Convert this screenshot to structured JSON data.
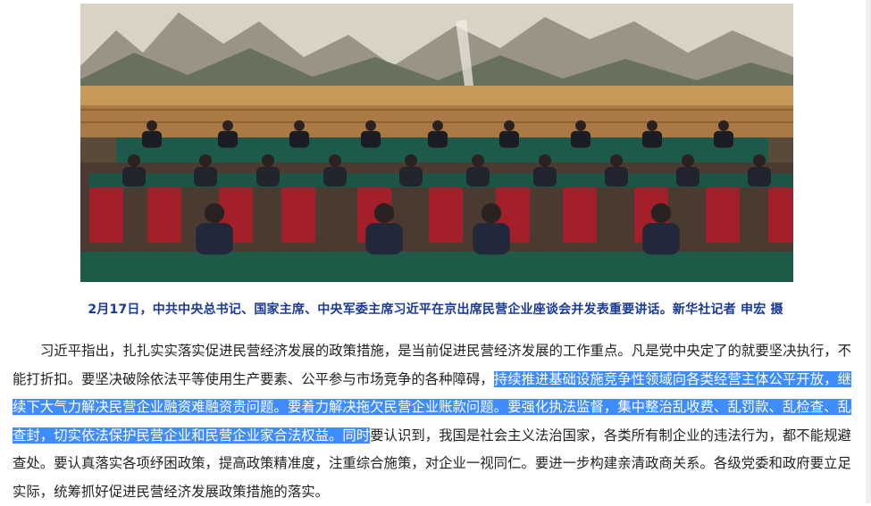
{
  "photo": {
    "alt": "news-photo",
    "colors": {
      "mural_sky": "#d8d2c4",
      "wall": "#b8874f",
      "table": "#1f5a4a",
      "chair": "#a3202a"
    }
  },
  "caption": "2月17日，中共中央总书记、国家主席、中央军委主席习近平在京出席民营企业座谈会并发表重要讲话。新华社记者 申宏 摄",
  "article": {
    "before_selection": "习近平指出，扎扎实实落实促进民营经济发展的政策措施，是当前促进民营经济发展的工作重点。凡是党中央定了的就要坚决执行，不能打折扣。要坚决破除依法平等使用生产要素、公平参与市场竞争的各种障碍，",
    "selected": "持续推进基础设施竞争性领域向各类经营主体公平开放，继续下大气力解决民营企业融资难融资贵问题。要着力解决拖欠民营企业账款问题。要强化执法监督，集中整治乱收费、乱罚款、乱检查、乱查封，切实依法保护民营企业和民营企业家合法权益。同时",
    "after_selection": "要认识到，我国是社会主义法治国家，各类所有制企业的违法行为，都不能规避查处。要认真落实各项纾困政策，提高政策精准度，注重综合施策，对企业一视同仁。要进一步构建亲清政商关系。各级党委和政府要立足实际，统筹抓好促进民营经济发展政策措施的落实。"
  }
}
